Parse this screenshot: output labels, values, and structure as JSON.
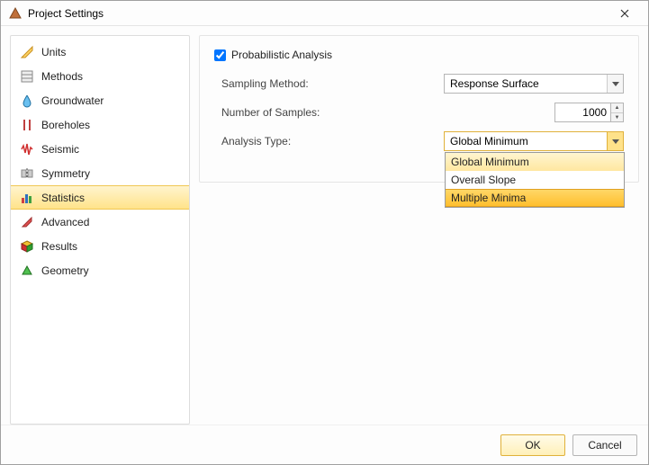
{
  "window": {
    "title": "Project Settings"
  },
  "sidebar": {
    "items": [
      {
        "label": "Units"
      },
      {
        "label": "Methods"
      },
      {
        "label": "Groundwater"
      },
      {
        "label": "Boreholes"
      },
      {
        "label": "Seismic"
      },
      {
        "label": "Symmetry"
      },
      {
        "label": "Statistics",
        "selected": true
      },
      {
        "label": "Advanced"
      },
      {
        "label": "Results"
      },
      {
        "label": "Geometry"
      }
    ]
  },
  "panel": {
    "checkbox": {
      "label": "Probabilistic Analysis",
      "checked": true
    },
    "sampling": {
      "label": "Sampling Method:",
      "value": "Response Surface"
    },
    "samples": {
      "label": "Number of Samples:",
      "value": "1000"
    },
    "analysis": {
      "label": "Analysis Type:",
      "value": "Global Minimum",
      "options": [
        "Global Minimum",
        "Overall Slope",
        "Multiple Minima"
      ]
    }
  },
  "buttons": {
    "ok": "OK",
    "cancel": "Cancel"
  }
}
